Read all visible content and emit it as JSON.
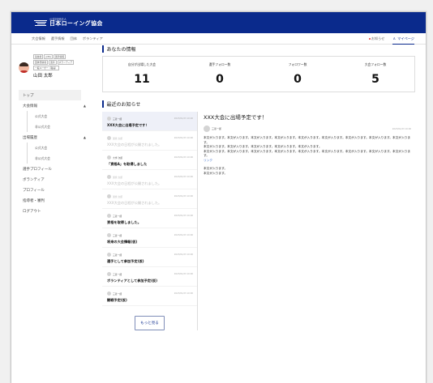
{
  "header": {
    "logo_sub": "公益社団法人",
    "logo_main": "日本ローイング協会"
  },
  "nav": {
    "items": [
      "大会情報",
      "選手情報",
      "団体",
      "ボランティア"
    ],
    "notifications": "お知らせ",
    "mypage": "マイページ"
  },
  "profile": {
    "tags": [
      "競技者",
      "pitta",
      "選手情報",
      "団体登録者",
      "選手",
      "ボランティア",
      "一般ユーザー（職員）"
    ],
    "name": "山田 太郎"
  },
  "menu": {
    "top": "トップ",
    "tournament": "大会情報",
    "tournament_sub": [
      "公式大会",
      "非公式大会"
    ],
    "results": "出場履歴",
    "results_sub": [
      "公式大会",
      "非公式大会"
    ],
    "player_profile": "選手プロフィール",
    "volunteer": "ボランティア",
    "profile": "プロフィール",
    "guardian": "指導者・審判",
    "logout": "ログアウト"
  },
  "stats_section": {
    "title": "あなたの情報",
    "items": [
      {
        "label": "自分が出場した大会",
        "value": "11"
      },
      {
        "label": "選手フォロー数",
        "value": "0"
      },
      {
        "label": "フォロワー数",
        "value": "0"
      },
      {
        "label": "大会フォロー数",
        "value": "5"
      }
    ]
  },
  "news_section": {
    "title": "最近のお知らせ",
    "items": [
      {
        "author": "三菱一郎",
        "date": "2023/01/23 10:00",
        "title": "XXX大会に出場予定です！",
        "state": "selected"
      },
      {
        "author": "運営 太郎",
        "date": "2023/01/23 10:00",
        "title": "XXX大会の日程が公開されました。",
        "state": "dim"
      },
      {
        "author": "大学 次郎",
        "date": "2023/01/23 10:00",
        "title": "「資格A」を取得しました",
        "state": "normal"
      },
      {
        "author": "運営 太郎",
        "date": "2023/01/23 10:00",
        "title": "XXX大会の日程が公開されました。",
        "state": "dim"
      },
      {
        "author": "運営 太郎",
        "date": "2023/01/23 10:00",
        "title": "XXX大会の日程が公開されました。",
        "state": "dim"
      },
      {
        "author": "三菱一郎",
        "date": "2023/01/23 10:00",
        "title": "資格を取得しました。",
        "state": "normal"
      },
      {
        "author": "三菱一郎",
        "date": "2023/01/23 10:00",
        "title": "将来の大会情報(仮)",
        "state": "normal"
      },
      {
        "author": "三菱一郎",
        "date": "2023/01/23 10:00",
        "title": "選手として参加予定(仮)",
        "state": "normal"
      },
      {
        "author": "三菱一郎",
        "date": "2023/01/23 10:00",
        "title": "ボランティアとして参加予定(仮)",
        "state": "normal"
      },
      {
        "author": "三菱一郎",
        "date": "2023/01/23 10:00",
        "title": "観戦予定(仮)",
        "state": "normal"
      }
    ],
    "more_button": "もっと見る"
  },
  "detail": {
    "title": "XXX大会に出場予定です！",
    "author": "三菱一郎",
    "date": "2023/01/23 10:00",
    "paragraph1": [
      "本文が入ります。本文が入ります。本文が入ります。本文が入ります。本文が入ります。本文が入ります。本文が入ります。本文が入ります。本文が入ります。",
      "本文が入ります。本文が入ります。本文が入ります。本文が入ります。本文が入ります。",
      "本文が入ります。本文が入ります。本文が入ります。本文が入ります。本文が入ります。本文が入ります。本文が入ります。本文が入ります。本文が入ります。"
    ],
    "link": "リンク",
    "paragraph2": [
      "本文が入ります。",
      "本文が入ります。"
    ]
  }
}
